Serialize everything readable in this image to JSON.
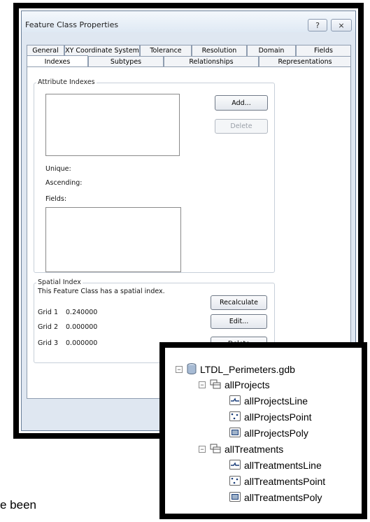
{
  "dialog": {
    "title": "Feature Class Properties",
    "help_glyph": "?",
    "close_glyph": "⨯",
    "tabs_row1": [
      "General",
      "XY Coordinate System",
      "Tolerance",
      "Resolution",
      "Domain",
      "Fields"
    ],
    "tabs_row2": [
      "Indexes",
      "Subtypes",
      "Relationships",
      "Representations"
    ],
    "active_tab": "Indexes",
    "attribute_indexes": {
      "legend": "Attribute Indexes",
      "add_label": "Add...",
      "delete_label": "Delete",
      "unique_label": "Unique:",
      "ascending_label": "Ascending:",
      "fields_label": "Fields:"
    },
    "spatial_index": {
      "legend": "Spatial Index",
      "status_text": "This Feature Class has a spatial index.",
      "grids": [
        {
          "label": "Grid 1",
          "value": "0.240000"
        },
        {
          "label": "Grid 2",
          "value": "0.000000"
        },
        {
          "label": "Grid 3",
          "value": "0.000000"
        }
      ],
      "recalculate_label": "Recalculate",
      "edit_label": "Edit...",
      "delete_label": "Delete"
    }
  },
  "tree": {
    "root": "LTDL_Perimeters.gdb",
    "datasets": [
      {
        "name": "allProjects",
        "children": [
          {
            "name": "allProjectsLine",
            "icon": "line-feature-icon"
          },
          {
            "name": "allProjectsPoint",
            "icon": "point-feature-icon"
          },
          {
            "name": "allProjectsPoly",
            "icon": "polygon-feature-icon"
          }
        ]
      },
      {
        "name": "allTreatments",
        "children": [
          {
            "name": "allTreatmentsLine",
            "icon": "line-feature-icon"
          },
          {
            "name": "allTreatmentsPoint",
            "icon": "point-feature-icon"
          },
          {
            "name": "allTreatmentsPoly",
            "icon": "polygon-feature-icon"
          }
        ]
      }
    ],
    "collapse_glyph": "−"
  },
  "caption_fragment": "e been"
}
